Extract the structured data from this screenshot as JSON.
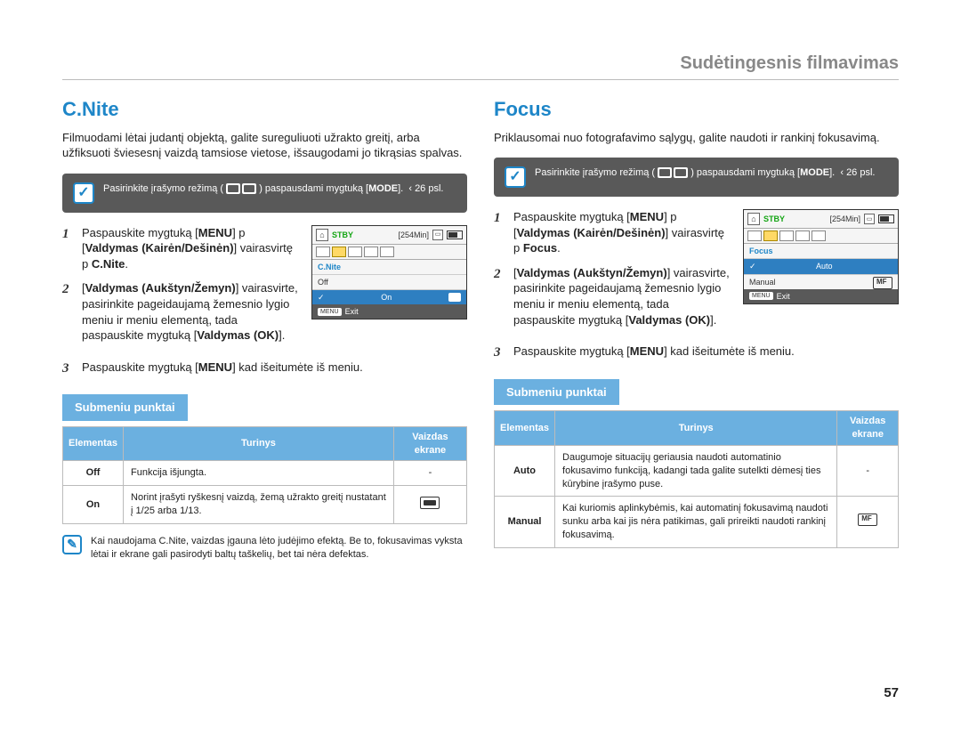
{
  "breadcrumb": "Sudėtingesnis filmavimas",
  "page_number": "57",
  "left": {
    "title": "C.Nite",
    "intro": "Filmuodami lėtai judantį objektą, galite sureguliuoti užrakto greitį, arba užfiksuoti šviesesnį vaizdą tamsiose vietose, išsaugodami jo tikrąsias spalvas.",
    "mode_box_pre": "Pasirinkite įrašymo režimą ( ",
    "mode_box_post": " ) paspausdami mygtuką ",
    "mode_box_btn": "MODE",
    "mode_box_ref": "‹ 26 psl.",
    "steps": [
      {
        "num": "1",
        "html_parts": [
          "Paspauskite mygtuką [",
          "MENU",
          "]  p [",
          "Valdymas (Kairėn/Dešinėn)",
          "] vairasvirtę  p ",
          "C.Nite",
          "."
        ]
      },
      {
        "num": "2",
        "html_parts": [
          "[",
          "Valdymas (Aukštyn/Žemyn)",
          "] vairasvirte, pasirinkite pageidaujamą žemesnio lygio meniu ir meniu elementą, tada paspauskite mygtuką [",
          "Valdymas (OK)",
          "]."
        ]
      },
      {
        "num": "3",
        "html_parts": [
          "Paspauskite mygtuką [",
          "MENU",
          "] kad išeitumėte iš meniu."
        ]
      }
    ],
    "submenu_title": "Submeniu punktai",
    "table_headers": [
      "Elementas",
      "Turinys",
      "Vaizdas ekrane"
    ],
    "table_rows": [
      {
        "item": "Off",
        "content": "Funkcija išjungta.",
        "display": "-"
      },
      {
        "item": "On",
        "content": "Norint įrašyti ryškesnį vaizdą, žemą užrakto greitį nustatant į 1/25 arba 1/13.",
        "display": "ICON"
      }
    ],
    "note": "Kai naudojama C.Nite, vaizdas įgauna lėto judėjimo efektą. Be to, fokusavimas vyksta lėtai ir ekrane gali pasirodyti baltų taškelių, bet tai nėra defektas.",
    "lcd": {
      "stby": "STBY",
      "time": "[254Min]",
      "menu_title": "C.Nite",
      "items": [
        "Off",
        "On"
      ],
      "selected": "On",
      "exit_btn": "MENU",
      "exit_text": "Exit"
    }
  },
  "right": {
    "title": "Focus",
    "intro": "Priklausomai nuo fotografavimo sąlygų, galite naudoti ir rankinį fokusavimą.",
    "mode_box_pre": "Pasirinkite įrašymo režimą ( ",
    "mode_box_post": " ) paspausdami mygtuką ",
    "mode_box_btn": "MODE",
    "mode_box_ref": "‹ 26 psl.",
    "steps": [
      {
        "num": "1",
        "html_parts": [
          "Paspauskite mygtuką [",
          "MENU",
          "]  p [",
          "Valdymas (Kairėn/Dešinėn)",
          "] vairasvirtę  p ",
          "Focus",
          "."
        ]
      },
      {
        "num": "2",
        "html_parts": [
          "[",
          "Valdymas (Aukštyn/Žemyn)",
          "] vairasvirte, pasirinkite pageidaujamą žemesnio lygio meniu ir meniu elementą, tada paspauskite mygtuką [",
          "Valdymas (OK)",
          "]."
        ]
      },
      {
        "num": "3",
        "html_parts": [
          "Paspauskite mygtuką [",
          "MENU",
          "] kad išeitumėte iš meniu."
        ]
      }
    ],
    "submenu_title": "Submeniu punktai",
    "table_headers": [
      "Elementas",
      "Turinys",
      "Vaizdas ekrane"
    ],
    "table_rows": [
      {
        "item": "Auto",
        "content": "Daugumoje situacijų geriausia naudoti automatinio fokusavimo funkciją, kadangi tada galite sutelkti dėmesį ties kūrybine įrašymo puse.",
        "display": "-"
      },
      {
        "item": "Manual",
        "content": "Kai kuriomis aplinkybėmis, kai automatinį fokusavimą naudoti sunku arba kai jis nėra patikimas, gali prireikti naudoti rankinį fokusavimą.",
        "display": "MF"
      }
    ],
    "lcd": {
      "stby": "STBY",
      "time": "[254Min]",
      "menu_title": "Focus",
      "items": [
        "Auto",
        "Manual"
      ],
      "selected": "Auto",
      "exit_btn": "MENU",
      "exit_text": "Exit"
    }
  }
}
